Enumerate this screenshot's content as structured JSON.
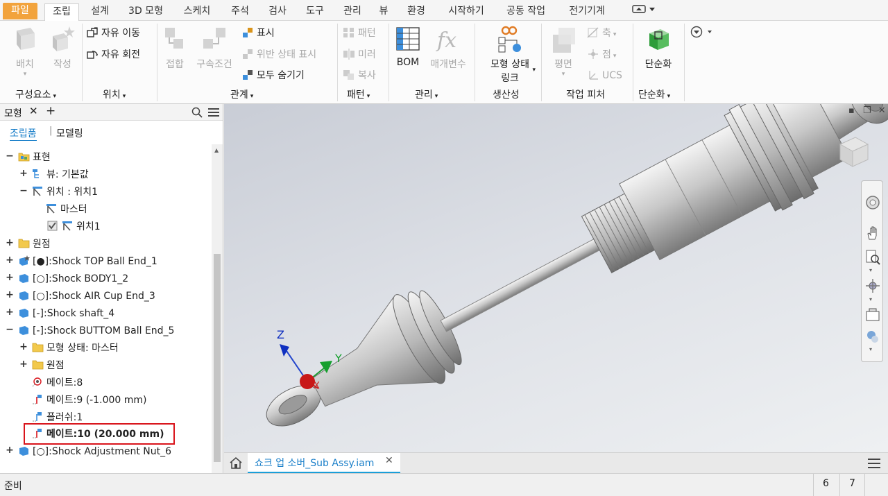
{
  "menu": {
    "tabs": [
      "파일",
      "조립",
      "설계",
      "3D 모형",
      "스케치",
      "주석",
      "검사",
      "도구",
      "관리",
      "뷰",
      "환경",
      "시작하기",
      "공동 작업",
      "전기기계"
    ]
  },
  "ribbon": {
    "component": {
      "place": "배치",
      "create": "작성",
      "group": "구성요소"
    },
    "position": {
      "free_move": "자유 이동",
      "free_rotate": "자유 회전",
      "group": "위치"
    },
    "relationships": {
      "joint": "접합",
      "constrain": "구속조건",
      "show": "표시",
      "show_sick": "위반 상태 표시",
      "hide_all": "모두 숨기기",
      "group": "관계"
    },
    "pattern": {
      "pattern": "패턴",
      "mirror": "미러",
      "copy": "복사",
      "group": "패턴"
    },
    "manage": {
      "bom": "BOM",
      "parameters": "매개변수",
      "group": "관리"
    },
    "productivity": {
      "model_state_link_1": "모형 상태",
      "model_state_link_2": "링크",
      "group": "생산성"
    },
    "work_features": {
      "plane": "평면",
      "axis": "축",
      "point": "점",
      "ucs": "UCS",
      "group": "작업 피처"
    },
    "simplification": {
      "simplify": "단순화",
      "group": "단순화"
    }
  },
  "browser": {
    "title": "모형",
    "tab_assembly": "조립품",
    "tab_modeling": "모델링",
    "nodes": [
      {
        "label": "표현"
      },
      {
        "label": "뷰: 기본값"
      },
      {
        "label": "위치 : 위치1"
      },
      {
        "label": "마스터"
      },
      {
        "label": "위치1"
      },
      {
        "label": "원점"
      },
      {
        "label": "[●]:Shock TOP Ball End_1"
      },
      {
        "label": "[○]:Shock BODY1_2"
      },
      {
        "label": "[○]:Shock AIR Cup End_3"
      },
      {
        "label": "[-]:Shock shaft_4"
      },
      {
        "label": "[-]:Shock BUTTOM Ball End_5"
      },
      {
        "label": "모형 상태: 마스터"
      },
      {
        "label": "원점"
      },
      {
        "label": "메이트:8"
      },
      {
        "label": "메이트:9 (-1.000 mm)"
      },
      {
        "label": "플러쉬:1"
      },
      {
        "label": "메이트:10 (20.000 mm)"
      },
      {
        "label": "[○]:Shock Adjustment Nut_6"
      }
    ]
  },
  "viewport": {
    "triad_x": "X",
    "triad_y": "Y",
    "triad_z": "Z"
  },
  "document_tab": {
    "label": "쇼크 업 소버_Sub Assy.iam"
  },
  "status": {
    "text": "준비",
    "count1": "6",
    "count2": "7"
  },
  "colors": {
    "file_tab": "#f2a33c",
    "accent_blue": "#1a9fd9",
    "highlight_red": "#d9141b",
    "part_blue": "#3d8fdc"
  }
}
